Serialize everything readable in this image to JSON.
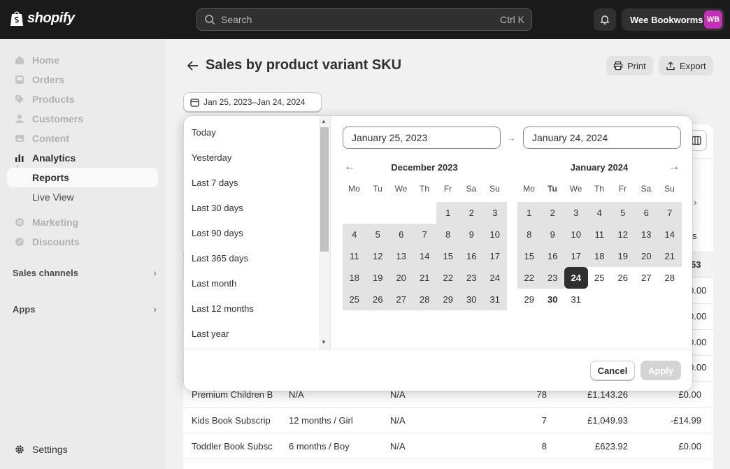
{
  "topbar": {
    "logo_text": "shopify",
    "search_placeholder": "Search",
    "search_shortcut": "Ctrl K",
    "store_name": "Wee Bookworms",
    "store_initials": "WB"
  },
  "sidebar": {
    "items": [
      {
        "label": "Home",
        "icon": "home-icon"
      },
      {
        "label": "Orders",
        "icon": "inbox-icon"
      },
      {
        "label": "Products",
        "icon": "tag-icon"
      },
      {
        "label": "Customers",
        "icon": "person-icon"
      },
      {
        "label": "Content",
        "icon": "image-icon"
      },
      {
        "label": "Analytics",
        "icon": "bar-chart-icon"
      },
      {
        "label": "Reports"
      },
      {
        "label": "Live View"
      },
      {
        "label": "Marketing",
        "icon": "target-icon"
      },
      {
        "label": "Discounts",
        "icon": "discount-icon"
      }
    ],
    "sales_channels": "Sales channels",
    "apps": "Apps",
    "settings": "Settings"
  },
  "page": {
    "title": "Sales by product variant SKU",
    "print_label": "Print",
    "export_label": "Export",
    "date_range_label": "Jan 25, 2023–Jan 24, 2024"
  },
  "table": {
    "rows": [
      {
        "product": "Premium Children B",
        "variant": "N/A",
        "sku": "N/A",
        "qty": "78",
        "gross": "£1,143.26",
        "disc": "£0.00"
      },
      {
        "product": "Kids Book Subscrip",
        "variant": "12 months / Girl",
        "sku": "N/A",
        "qty": "7",
        "gross": "£1,049.93",
        "disc": "-£14.99"
      },
      {
        "product": "Toddler Book Subsc",
        "variant": "6 months / Boy",
        "sku": "N/A",
        "qty": "8",
        "gross": "£623.92",
        "disc": "£0.00"
      }
    ],
    "partial_right": [
      "s",
      "53",
      "0.00",
      "0.00",
      "0.00",
      "0.00"
    ]
  },
  "datepicker": {
    "presets": [
      "Today",
      "Yesterday",
      "Last 7 days",
      "Last 30 days",
      "Last 90 days",
      "Last 365 days",
      "Last month",
      "Last 12 months",
      "Last year"
    ],
    "start_value": "January 25, 2023",
    "end_value": "January 24, 2024",
    "weekdays": [
      "Mo",
      "Tu",
      "We",
      "Th",
      "Fr",
      "Sa",
      "Su"
    ],
    "left_month": {
      "title": "December 2023",
      "weeks": [
        [
          "",
          "",
          "",
          "",
          "1",
          "2",
          "3"
        ],
        [
          "4",
          "5",
          "6",
          "7",
          "8",
          "9",
          "10"
        ],
        [
          "11",
          "12",
          "13",
          "14",
          "15",
          "16",
          "17"
        ],
        [
          "18",
          "19",
          "20",
          "21",
          "22",
          "23",
          "24"
        ],
        [
          "25",
          "26",
          "27",
          "28",
          "29",
          "30",
          "31"
        ]
      ]
    },
    "right_month": {
      "title": "January 2024",
      "weeks": [
        [
          "1",
          "2",
          "3",
          "4",
          "5",
          "6",
          "7"
        ],
        [
          "8",
          "9",
          "10",
          "11",
          "12",
          "13",
          "14"
        ],
        [
          "15",
          "16",
          "17",
          "18",
          "19",
          "20",
          "21"
        ],
        [
          "22",
          "23",
          "24",
          "25",
          "26",
          "27",
          "28"
        ],
        [
          "29",
          "30",
          "31",
          "",
          "",
          "",
          ""
        ]
      ],
      "range_end_day": "24",
      "today_day": "30"
    },
    "cancel_label": "Cancel",
    "apply_label": "Apply"
  }
}
